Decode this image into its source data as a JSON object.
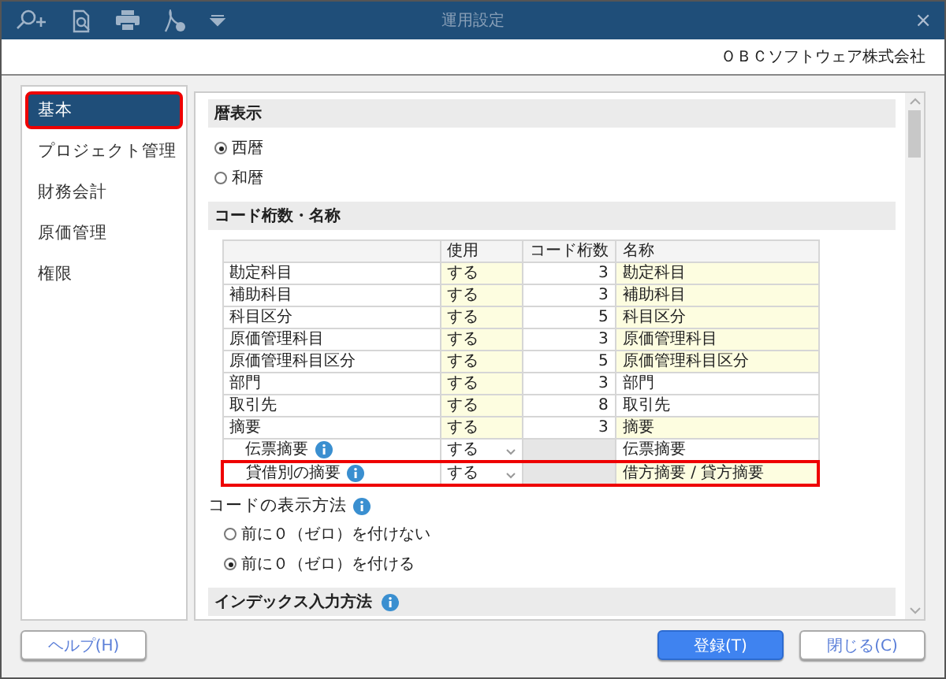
{
  "window": {
    "title": "運用設定",
    "close": "×"
  },
  "company": "ＯＢＣソフトウェア株式会社",
  "sidebar": {
    "items": [
      {
        "label": "基本",
        "selected": true,
        "highlighted": true
      },
      {
        "label": "プロジェクト管理",
        "selected": false,
        "highlighted": false
      },
      {
        "label": "財務会計",
        "selected": false,
        "highlighted": false
      },
      {
        "label": "原価管理",
        "selected": false,
        "highlighted": false
      },
      {
        "label": "権限",
        "selected": false,
        "highlighted": false
      }
    ]
  },
  "calendar": {
    "title": "暦表示",
    "options": [
      {
        "label": "西暦",
        "selected": true
      },
      {
        "label": "和暦",
        "selected": false
      }
    ]
  },
  "code_section": {
    "title": "コード桁数・名称",
    "columns": [
      "",
      "使用",
      "コード桁数",
      "名称"
    ],
    "rows": [
      {
        "kind": "plain",
        "item": "勘定科目",
        "use": "する",
        "digits": "3",
        "name": "勘定科目",
        "name_editable": true,
        "highlighted": false
      },
      {
        "kind": "plain",
        "item": "補助科目",
        "use": "する",
        "digits": "3",
        "name": "補助科目",
        "name_editable": true,
        "highlighted": false
      },
      {
        "kind": "plain",
        "item": "科目区分",
        "use": "する",
        "digits": "5",
        "name": "科目区分",
        "name_editable": true,
        "highlighted": false
      },
      {
        "kind": "plain",
        "item": "原価管理科目",
        "use": "する",
        "digits": "3",
        "name": "原価管理科目",
        "name_editable": true,
        "highlighted": false
      },
      {
        "kind": "plain",
        "item": "原価管理科目区分",
        "use": "する",
        "digits": "5",
        "name": "原価管理科目区分",
        "name_editable": true,
        "highlighted": false
      },
      {
        "kind": "plain",
        "item": "部門",
        "use": "する",
        "digits": "3",
        "name": "部門",
        "name_editable": false,
        "highlighted": false
      },
      {
        "kind": "plain",
        "item": "取引先",
        "use": "する",
        "digits": "8",
        "name": "取引先",
        "name_editable": false,
        "highlighted": false
      },
      {
        "kind": "plain",
        "item": "摘要",
        "use": "する",
        "digits": "3",
        "name": "摘要",
        "name_editable": true,
        "highlighted": false
      },
      {
        "kind": "sub",
        "item": "伝票摘要",
        "use": "する",
        "name": "伝票摘要",
        "name_editable": false,
        "highlighted": false
      },
      {
        "kind": "sub",
        "item": "貸借別の摘要",
        "use": "する",
        "name": "借方摘要 / 貸方摘要",
        "name_editable": true,
        "highlighted": true
      }
    ]
  },
  "code_display": {
    "title": "コードの表示方法",
    "options": [
      {
        "label": "前に０（ゼロ）を付けない",
        "selected": false
      },
      {
        "label": "前に０（ゼロ）を付ける",
        "selected": true
      }
    ]
  },
  "index_section": {
    "title": "インデックス入力方法"
  },
  "buttons": {
    "help": "ヘルプ(H)",
    "register": "登録(T)",
    "close": "閉じる(C)"
  }
}
